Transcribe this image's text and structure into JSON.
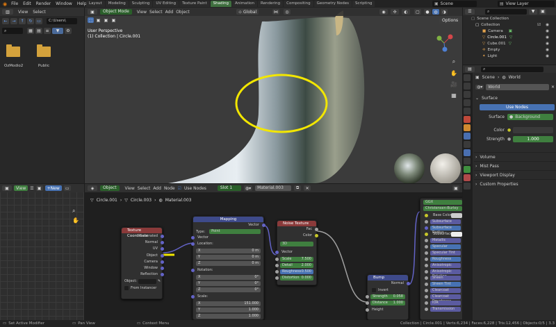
{
  "topbar": {
    "menus": [
      "File",
      "Edit",
      "Render",
      "Window",
      "Help"
    ],
    "workspaces": [
      "Layout",
      "Modeling",
      "Sculpting",
      "UV Editing",
      "Texture Paint",
      "Shading",
      "Animation",
      "Rendering",
      "Compositing",
      "Geometry Nodes",
      "Scripting"
    ],
    "active_workspace": "Shading",
    "scene": "Scene",
    "view_layer": "View Layer"
  },
  "filebrowser": {
    "menus": [
      "View",
      "Select"
    ],
    "path": "C:\\Users\\",
    "folders": [
      "OzModio2",
      "Public"
    ]
  },
  "viewport": {
    "mode": "Object Mode",
    "menus": [
      "View",
      "Select",
      "Add",
      "Object"
    ],
    "transform": "Global",
    "options": "Options",
    "title": "User Perspective",
    "subtitle": "(1) Collection | Circle.001"
  },
  "outliner": {
    "root": "Scene Collection",
    "items": [
      {
        "label": "Collection",
        "icon": "collection-icon"
      },
      {
        "label": "Camera",
        "icon": "camera-icon"
      },
      {
        "label": "Circle.001",
        "icon": "circle-icon"
      },
      {
        "label": "Cube.001",
        "icon": "cube-icon"
      },
      {
        "label": "Empty",
        "icon": "empty-icon"
      },
      {
        "label": "Light",
        "icon": "light-icon"
      }
    ]
  },
  "properties": {
    "breadcrumb_scene": "Scene",
    "breadcrumb_world": "World",
    "world_name": "World",
    "surface_label": "Surface",
    "use_nodes": "Use Nodes",
    "surface_field": "Surface",
    "surface_value": "Background",
    "color_label": "Color",
    "strength_label": "Strength",
    "strength_value": "1.000",
    "panels": [
      "Volume",
      "Mist Pass",
      "Viewport Display",
      "Custom Properties"
    ]
  },
  "imageeditor": {
    "view": "View",
    "new": "New"
  },
  "nodeeditor": {
    "type": "Object",
    "menus": [
      "View",
      "Select",
      "Add",
      "Node"
    ],
    "use_nodes": "Use Nodes",
    "slot": "Slot 1",
    "material": "Material.003",
    "breadcrumb": [
      "Circle.001",
      "Circle.003",
      "Material.003"
    ]
  },
  "nodes": {
    "texcoord": {
      "title": "Texture Coordinate",
      "outputs": [
        "Generated",
        "Normal",
        "UV",
        "Object",
        "Camera",
        "Window",
        "Reflection"
      ],
      "object_label": "Object:",
      "from_instancer": "From Instancer"
    },
    "mapping": {
      "title": "Mapping",
      "output": "Vector",
      "type_label": "Type:",
      "type_value": "Point",
      "vector": "Vector",
      "location": "Location:",
      "loc": [
        [
          "X",
          "0 m"
        ],
        [
          "Y",
          "0 m"
        ],
        [
          "Z",
          "0 m"
        ]
      ],
      "rotation": "Rotation:",
      "rot": [
        [
          "X",
          "0°"
        ],
        [
          "Y",
          "0°"
        ],
        [
          "Z",
          "0°"
        ]
      ],
      "scale": "Scale:",
      "scl": [
        [
          "X",
          "151.000"
        ],
        [
          "Y",
          "1.000"
        ],
        [
          "Z",
          "1.000"
        ]
      ]
    },
    "noise": {
      "title": "Noise Texture",
      "outputs": [
        "Fac",
        "Color"
      ],
      "dim": "3D",
      "vector": "Vector",
      "params": [
        [
          "Scale",
          "7.500"
        ],
        [
          "Detail",
          "2.000"
        ],
        [
          "Roughness",
          "0.500"
        ],
        [
          "Distortion",
          "0.000"
        ]
      ]
    },
    "bump": {
      "title": "Bump",
      "output": "Normal",
      "invert": "Invert",
      "strength_label": "Strength",
      "strength_value": "0.058",
      "distance_label": "Distance",
      "distance_value": "1.000",
      "height": "Height"
    },
    "bsdf": {
      "label1": "GGX",
      "label2": "Christensen-Burley",
      "inputs": [
        "Base Color",
        "Subsurface",
        "Subsurface Radius",
        "Subsurface Col",
        "Metallic",
        "Specular",
        "Specular Tint",
        "Roughness",
        "Anisotropic",
        "Anisotropic Rotation",
        "Sheen",
        "Sheen Tint",
        "Clearcoat",
        "Clearcoat Roughness",
        "IOR",
        "Transmission"
      ]
    }
  },
  "statusbar": {
    "left1": "Set Active Modifier",
    "left2": "Pan View",
    "left3": "Context Menu",
    "stats": "Collection | Circle.001 | Verts:6,234 | Faces:6,228 | Tris:12,456 | Objects:0/5 | 3.3"
  },
  "colors": {
    "accent_green": "#3f8f3f",
    "highlight_yellow": "#f2e600",
    "node_texture": "#8a3a3a",
    "node_vector": "#3e4a8a",
    "node_noise": "#c86432",
    "bsdf_input": "#5b5ba0"
  }
}
